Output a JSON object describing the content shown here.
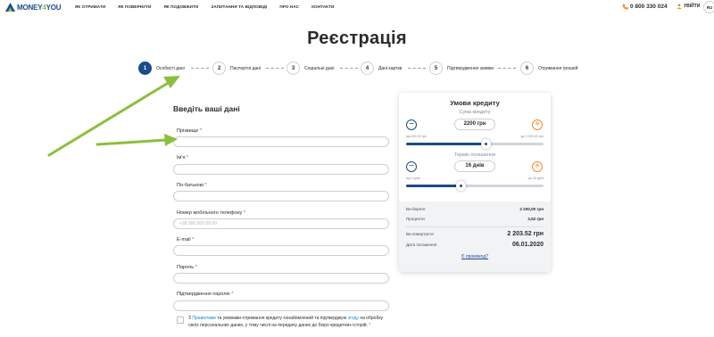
{
  "header": {
    "logo_text_a": "MONEY",
    "logo_text_b": "4",
    "logo_text_c": "YOU",
    "nav": [
      "ЯК ОТРИМАТИ",
      "ЯК ПОВЕРНУТИ",
      "ЯК ПОДОВЖИТИ",
      "ЗАПИТАННЯ ТА ВІДПОВІДІ",
      "ПРО НАС",
      "КОНТАКТИ"
    ],
    "phone": "0 800 330 024",
    "login": "УВІЙТИ",
    "lang": "RU"
  },
  "page_title": "Реєстрація",
  "steps": [
    {
      "num": "1",
      "label": "Особисті дані"
    },
    {
      "num": "2",
      "label": "Паспортні дані"
    },
    {
      "num": "3",
      "label": "Соціальні дані"
    },
    {
      "num": "4",
      "label": "Дані картки"
    },
    {
      "num": "5",
      "label": "Підтвердження заявки"
    },
    {
      "num": "6",
      "label": "Отримання грошей"
    }
  ],
  "active_step": 1,
  "form": {
    "title": "Введіть ваші дані",
    "fields": [
      {
        "label": "Прізвище",
        "placeholder": "",
        "value": ""
      },
      {
        "label": "Ім'я",
        "placeholder": "",
        "value": ""
      },
      {
        "label": "По-батькові",
        "placeholder": "",
        "value": ""
      },
      {
        "label": "Номер мобільного телефону",
        "placeholder": "+38 000 000 00 00",
        "value": ""
      },
      {
        "label": "E-mail",
        "placeholder": "",
        "value": ""
      },
      {
        "label": "Пароль",
        "placeholder": "",
        "value": ""
      },
      {
        "label": "Підтвердження паролю",
        "placeholder": "",
        "value": ""
      }
    ],
    "required_mark": "*",
    "consent": {
      "prefix": "З ",
      "link1": "Правилами",
      "middle": " та умовами отримання кредиту ознайомлений та підтверджую ",
      "link2": "згоду",
      "suffix": " на обробку своїх персональних даних, у тому числі на передачу даних до бюро кредитних історій.",
      "req": "*"
    }
  },
  "credit": {
    "title": "Умови кредиту",
    "amount_label": "Сума кредиту",
    "amount_value": "2200 грн",
    "amount_min": "від 500,00 грн",
    "amount_max": "до 3 000,00 грн",
    "amount_fraction": 0.58,
    "term_label": "Термін погашення",
    "term_value": "16 днів",
    "term_min": "від 2 днів",
    "term_max": "до 30 днів",
    "term_fraction": 0.4,
    "minus": "−",
    "plus": "+",
    "rows": [
      {
        "k": "Ви берете",
        "v": "2 200,00 грн"
      },
      {
        "k": "Проценти",
        "v": "3,52 грн"
      },
      {
        "k": "Ви повертаєте",
        "v": "2 203.52 грн"
      },
      {
        "k": "Дата погашення",
        "v": "06.01.2020"
      }
    ],
    "promo": "Є промокод?"
  },
  "colors": {
    "brand_blue": "#1a4b8c",
    "accent_orange": "#f28a2e",
    "accent_green": "#8cc63f",
    "required_red": "#e8302e"
  }
}
